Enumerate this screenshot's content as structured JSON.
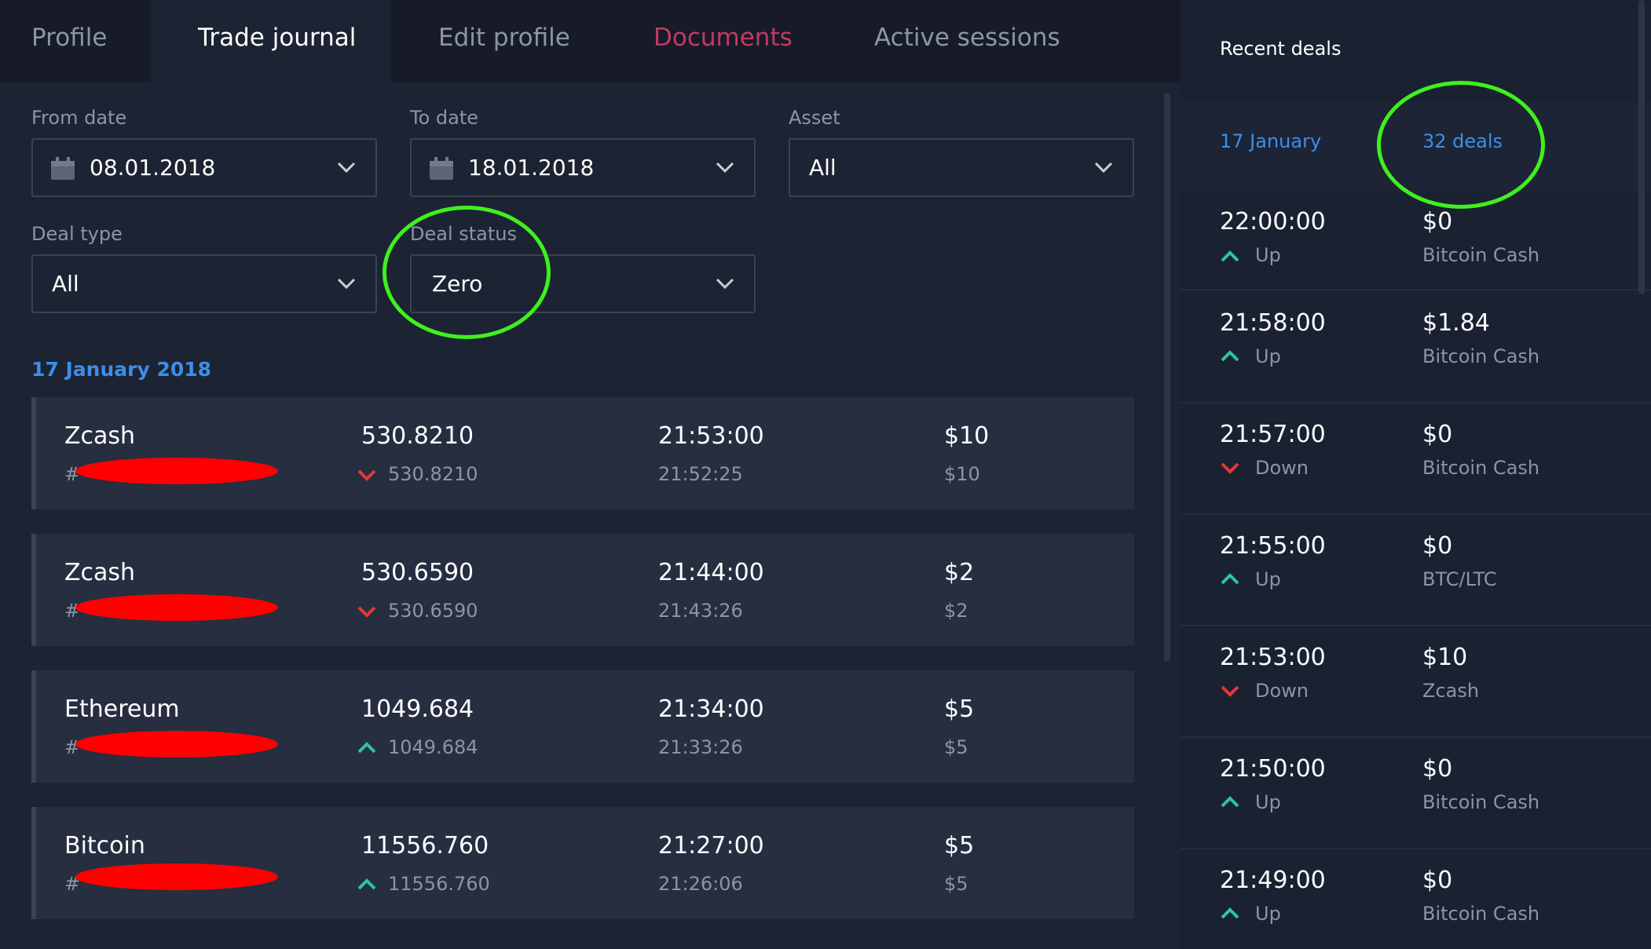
{
  "colors": {
    "accent_blue": "#3d8ee8",
    "up_green": "#2bc5a0",
    "down_red": "#e5363c",
    "documents_pink": "#c33a63",
    "annotation_green": "#3ff01e",
    "redaction_red": "#ff0000"
  },
  "tabs": [
    {
      "label": "Profile",
      "active": false
    },
    {
      "label": "Trade journal",
      "active": true
    },
    {
      "label": "Edit profile",
      "active": false
    },
    {
      "label": "Documents",
      "active": false
    },
    {
      "label": "Active sessions",
      "active": false
    }
  ],
  "filters": {
    "from_date": {
      "label": "From date",
      "value": "08.01.2018",
      "icon": "calendar-icon"
    },
    "to_date": {
      "label": "To date",
      "value": "18.01.2018",
      "icon": "calendar-icon"
    },
    "asset": {
      "label": "Asset",
      "value": "All"
    },
    "deal_type": {
      "label": "Deal type",
      "value": "All"
    },
    "deal_status": {
      "label": "Deal status",
      "value": "Zero"
    }
  },
  "journal": {
    "group_date": "17 January 2018",
    "deals": [
      {
        "asset": "Zcash",
        "id_prefix": "#",
        "price": "530.8210",
        "price_close": "530.8210",
        "direction": "down",
        "time_expire": "21:53:00",
        "time_open": "21:52:25",
        "amount": "$10",
        "amount_small": "$10"
      },
      {
        "asset": "Zcash",
        "id_prefix": "#",
        "price": "530.6590",
        "price_close": "530.6590",
        "direction": "down",
        "time_expire": "21:44:00",
        "time_open": "21:43:26",
        "amount": "$2",
        "amount_small": "$2"
      },
      {
        "asset": "Ethereum",
        "id_prefix": "#",
        "price": "1049.684",
        "price_close": "1049.684",
        "direction": "up",
        "time_expire": "21:34:00",
        "time_open": "21:33:26",
        "amount": "$5",
        "amount_small": "$5"
      },
      {
        "asset": "Bitcoin",
        "id_prefix": "#",
        "price": "11556.760",
        "price_close": "11556.760",
        "direction": "up",
        "time_expire": "21:27:00",
        "time_open": "21:26:06",
        "amount": "$5",
        "amount_small": "$5"
      }
    ]
  },
  "recent": {
    "title": "Recent deals",
    "date": "17 January",
    "count": "32 deals",
    "items": [
      {
        "time": "22:00:00",
        "direction": "up",
        "direction_label": "Up",
        "amount": "$0",
        "asset": "Bitcoin Cash"
      },
      {
        "time": "21:58:00",
        "direction": "up",
        "direction_label": "Up",
        "amount": "$1.84",
        "asset": "Bitcoin Cash"
      },
      {
        "time": "21:57:00",
        "direction": "down",
        "direction_label": "Down",
        "amount": "$0",
        "asset": "Bitcoin Cash"
      },
      {
        "time": "21:55:00",
        "direction": "up",
        "direction_label": "Up",
        "amount": "$0",
        "asset": "BTC/LTC"
      },
      {
        "time": "21:53:00",
        "direction": "down",
        "direction_label": "Down",
        "amount": "$10",
        "asset": "Zcash"
      },
      {
        "time": "21:50:00",
        "direction": "up",
        "direction_label": "Up",
        "amount": "$0",
        "asset": "Bitcoin Cash"
      },
      {
        "time": "21:49:00",
        "direction": "up",
        "direction_label": "Up",
        "amount": "$0",
        "asset": "Bitcoin Cash"
      }
    ]
  }
}
